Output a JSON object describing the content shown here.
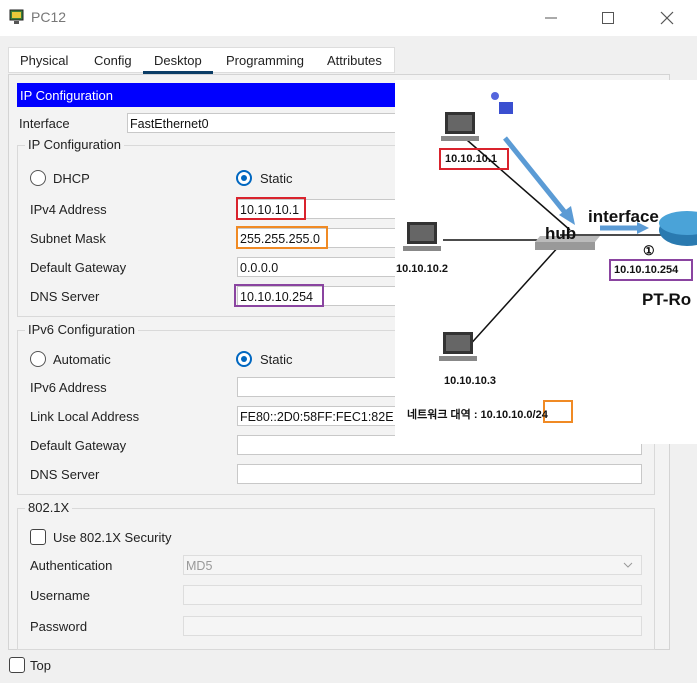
{
  "window": {
    "title": "PC12"
  },
  "tabs": [
    "Physical",
    "Config",
    "Desktop",
    "Programming",
    "Attributes"
  ],
  "ip_config": {
    "header": "IP Configuration",
    "interface_label": "Interface",
    "interface_value": "FastEthernet0",
    "ipv4_group_title": "IP Configuration",
    "dhcp_label": "DHCP",
    "static_label": "Static",
    "ipv4_label": "IPv4 Address",
    "ipv4_value": "10.10.10.1",
    "subnet_label": "Subnet Mask",
    "subnet_value": "255.255.255.0",
    "gateway_label": "Default Gateway",
    "gateway_value": "0.0.0.0",
    "dns_label": "DNS Server",
    "dns_value": "10.10.10.254",
    "ipv6_group_title": "IPv6 Configuration",
    "automatic_label": "Automatic",
    "static6_label": "Static",
    "ipv6_label": "IPv6 Address",
    "ipv6_value": "",
    "link_local_label": "Link Local Address",
    "link_local_value": "FE80::2D0:58FF:FEC1:82E",
    "gateway6_label": "Default Gateway",
    "gateway6_value": "",
    "dns6_label": "DNS Server",
    "dns6_value": "",
    "dot1x_group_title": "802.1X",
    "use_dot1x_label": "Use 802.1X Security",
    "auth_label": "Authentication",
    "auth_value": "MD5",
    "username_label": "Username",
    "username_value": "",
    "password_label": "Password",
    "password_value": ""
  },
  "bottom": {
    "top_label": "Top"
  },
  "diagram": {
    "pc1_ip": "10.10.10.1",
    "pc2_ip": "10.10.10.2",
    "pc3_ip": "10.10.10.3",
    "hub_label": "hub",
    "interface_label": "interface",
    "circle_number": "①",
    "router_ip": "10.10.10.254",
    "router_label": "PT-Ro",
    "network_label": "네트워크 대역 : 10.10.10.0/24"
  },
  "colors": {
    "header_blue": "#0000ff",
    "radio_blue": "#0067c0",
    "mark_red": "#d9232d",
    "mark_orange": "#f08a24",
    "mark_purple": "#8a44a0",
    "arrow_blue": "#5b9bd5"
  }
}
